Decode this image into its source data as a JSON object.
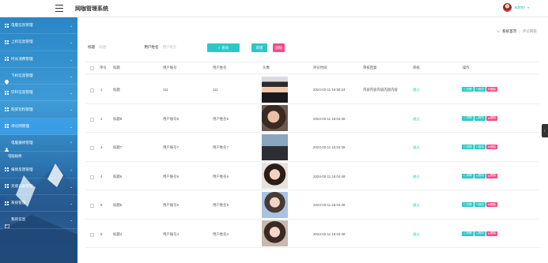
{
  "header": {
    "title": "网咖管理系统",
    "user_name": "admin",
    "caret": "▾"
  },
  "sidebar": {
    "items": [
      {
        "label": "电脑信息管理",
        "icon": "grid-icon",
        "arrow": "⌄"
      },
      {
        "label": "上机信息管理",
        "icon": "grid-icon",
        "arrow": "⌄"
      },
      {
        "label": "时长消费管理",
        "icon": "grid-icon",
        "arrow": "⌄"
      },
      {
        "label": "下机信息管理",
        "icon": "map-pin-icon",
        "arrow": "⌄"
      },
      {
        "label": "饮料信息管理",
        "icon": "grid-icon",
        "arrow": "⌄"
      },
      {
        "label": "购买饮料管理",
        "icon": "grid-icon",
        "arrow": "⌄"
      },
      {
        "label": "评论网管理",
        "icon": "grid-icon",
        "arrow": "⌄"
      },
      {
        "label": "电脑报修管理",
        "icon": "user-icon",
        "arrow": "⌃"
      },
      {
        "label": "报修反馈管理",
        "icon": "grid-icon",
        "arrow": "⌄"
      },
      {
        "label": "充值记录管理",
        "icon": "grid-icon",
        "arrow": "⌄"
      },
      {
        "label": "系统管理",
        "icon": "grid-icon",
        "arrow": "⌄"
      },
      {
        "label": "我的信息",
        "icon": "card-icon",
        "arrow": "⌄"
      }
    ],
    "submenu_label": "电脑报修",
    "active_index": 6
  },
  "breadcrumb": {
    "home": "系统首页",
    "separator": "/",
    "current": "评论网管"
  },
  "search": {
    "title_label": "标题",
    "title_placeholder": "标题",
    "account_label": "用户姓名",
    "account_placeholder": "用户姓名",
    "search_button": "查询",
    "add_button": "新增",
    "delete_button": "删除"
  },
  "table": {
    "headers": {
      "index": "序号",
      "title": "标题",
      "account": "用户账号",
      "name": "用户姓名",
      "avatar": "头像",
      "time": "评论时间",
      "reply": "审核回复",
      "status": "审核",
      "ops": "操作"
    },
    "rows": [
      {
        "index": "1",
        "title": "标题",
        "account": "111",
        "name": "111",
        "time": "2024-03-11 16:50:24",
        "reply": "内容内容内容内容内容",
        "status": "通过",
        "photo": "p1"
      },
      {
        "index": "2",
        "title": "标题8",
        "account": "用户账号8",
        "name": "用户姓名8",
        "time": "2024-03-11 16:04:49",
        "reply": "",
        "status": "通过",
        "photo": "p2"
      },
      {
        "index": "3",
        "title": "标题7",
        "account": "用户账号7",
        "name": "用户姓名7",
        "time": "2024-03-11 16:04:49",
        "reply": "",
        "status": "通过",
        "photo": "p3"
      },
      {
        "index": "4",
        "title": "标题6",
        "account": "用户账号6",
        "name": "用户姓名6",
        "time": "2024-03-11 16:04:49",
        "reply": "",
        "status": "通过",
        "photo": "p4"
      },
      {
        "index": "5",
        "title": "标题5",
        "account": "用户账号5",
        "name": "用户姓名5",
        "time": "2024-03-11 16:04:49",
        "reply": "",
        "status": "通过",
        "photo": "p5"
      },
      {
        "index": "6",
        "title": "标题4",
        "account": "用户账号4",
        "name": "用户姓名4",
        "time": "2024-03-11 16:04:49",
        "reply": "",
        "status": "通过",
        "photo": "p6"
      }
    ],
    "op_labels": {
      "detail": "详情",
      "edit": "修改",
      "delete": "删除"
    }
  },
  "colors": {
    "accent": "#2ec7c9",
    "danger": "#f24c8a",
    "sidebar_top": "#2a86c6",
    "sidebar_bottom": "#1f4c85"
  },
  "side_handle": "‹"
}
